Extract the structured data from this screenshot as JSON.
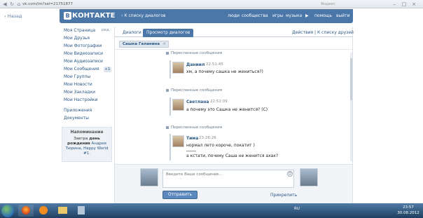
{
  "browser": {
    "url": "vk.com/im?sel=21751877",
    "search_placeholder": "Яндекс",
    "back_label": "Назад"
  },
  "header": {
    "logo_text": "КОНТАКТЕ",
    "logo_badge": "В",
    "dialogs_back": "К списку диалогов",
    "nav": {
      "people": "люди",
      "communities": "сообщества",
      "games": "игры",
      "music": "музыка",
      "help": "помощь",
      "logout": "выйти"
    }
  },
  "menu": {
    "items": [
      "Моя Страница",
      "Мои Друзья",
      "Мои Фотографии",
      "Мои Видеозаписи",
      "Мои Аудиозаписи",
      "Мои Сообщения",
      "Мои Группы",
      "Мои Новости",
      "Мои Закладки",
      "Мои Настройки",
      "Приложения",
      "Документы"
    ],
    "edit_label": "ред.",
    "messages_badge": "+1"
  },
  "reminder": {
    "title": "Напоминание",
    "line1": "Завтра",
    "line1_bold": "день рождения",
    "names": "Андрея Тюрина, Happy World #1."
  },
  "tabs": {
    "dialogs": "Диалоги",
    "view_dialogs": "Просмотр диалогов",
    "actions": "Действия",
    "to_friends": "К списку друзей",
    "separator": "|"
  },
  "recipient_chip": {
    "name": "Сашка Галанина",
    "close": "×"
  },
  "messages": [
    {
      "label": "Пересланные сообщения",
      "sender": "Даниил",
      "time": "22:51:45",
      "lines": [
        "хм, а почему сашка не жениться?)"
      ]
    },
    {
      "label": "Пересланные сообщения",
      "sender": "Светлана",
      "time": "22:52:09",
      "lines": [
        "а почему это Сашка не женится? (С)"
      ]
    },
    {
      "label": "Пересланные сообщения",
      "sender": "Тима",
      "time": "23:26:26",
      "lines": [
        "нормал лето короче, покатит )",
        "а кстати, почему Саша не женится ахах?"
      ]
    }
  ],
  "composer": {
    "placeholder": "Введите Ваше сообщение...",
    "send_label": "Отправить",
    "attach_label": "Прикрепить"
  },
  "taskbar": {
    "lang": "RU",
    "time": "23:57",
    "date": "30.08.2012"
  },
  "window_controls": [
    "–",
    "□",
    "×"
  ]
}
